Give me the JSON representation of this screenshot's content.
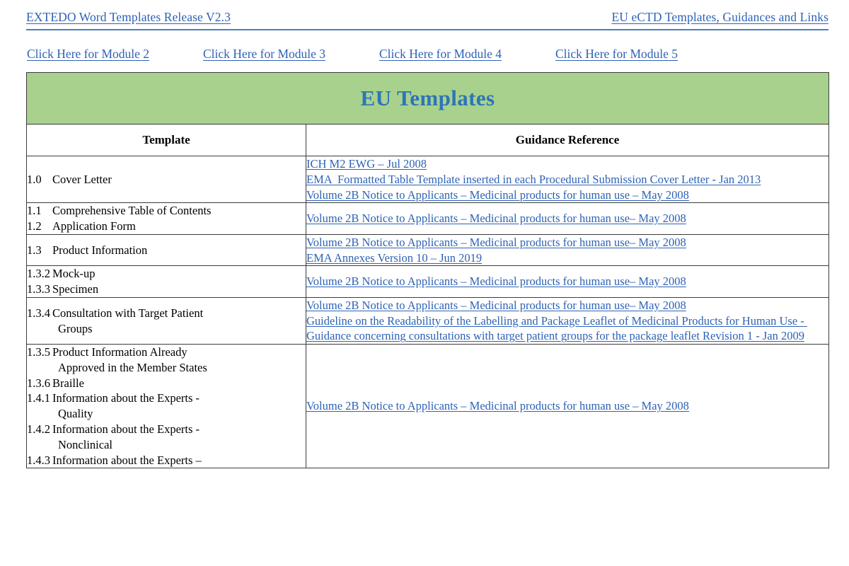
{
  "header": {
    "left_title": "EXTEDO Word Templates Release V2.3",
    "right_title": "EU eCTD Templates, Guidances and Links"
  },
  "module_links": [
    {
      "label": "Click Here for Module 2"
    },
    {
      "label": "Click Here for Module 3"
    },
    {
      "label": "Click Here for Module 4"
    },
    {
      "label": "Click Here for Module 5"
    }
  ],
  "table": {
    "banner_title": "EU Templates",
    "banner_color": "#a9d18e",
    "link_color": "#2e62b5",
    "columns": [
      {
        "label": "Template"
      },
      {
        "label": "Guidance Reference"
      }
    ],
    "rows": [
      {
        "template_lines": [
          {
            "num": "1.0",
            "text": "Cover Letter"
          }
        ],
        "template_align": "middle",
        "references": [
          "ICH M2 EWG – Jul 2008",
          "EMA  Formatted Table Template inserted in each Procedural Submission Cover Letter - Jan 2013",
          "Volume 2B Notice to Applicants – Medicinal products for human use – May 2008"
        ],
        "reference_align": "top"
      },
      {
        "template_lines": [
          {
            "num": "1.1",
            "text": "Comprehensive Table of Contents"
          },
          {
            "num": "1.2",
            "text": "Application Form"
          }
        ],
        "template_align": "top",
        "references": [
          "Volume 2B Notice to Applicants – Medicinal products for human use– May 2008"
        ],
        "reference_align": "middle"
      },
      {
        "template_lines": [
          {
            "num": "1.3",
            "text": "Product Information"
          }
        ],
        "template_align": "middle",
        "references": [
          "Volume 2B Notice to Applicants – Medicinal products for human use– May 2008",
          "EMA Annexes Version 10 – Jun 2019"
        ],
        "reference_align": "middle"
      },
      {
        "template_lines": [
          {
            "num": "1.3.2",
            "text": "Mock-up"
          },
          {
            "num": "1.3.3",
            "text": "Specimen"
          }
        ],
        "template_align": "middle",
        "references": [
          "Volume 2B Notice to Applicants – Medicinal products for human use– May 2008"
        ],
        "reference_align": "middle"
      },
      {
        "template_lines": [
          {
            "num": "1.3.4",
            "text": "Consultation with Target Patient"
          },
          {
            "num": "",
            "text": "Groups",
            "indent": true
          }
        ],
        "template_align": "middle",
        "references": [
          "Volume 2B Notice to Applicants – Medicinal products for human use– May 2008",
          "Guideline on the Readability of the Labelling and Package Leaflet of Medicinal Products for Human Use - Guidance concerning consultations with target patient groups for the package leaflet Revision 1 - Jan 2009"
        ],
        "reference_align": "top"
      },
      {
        "template_lines": [
          {
            "num": "1.3.5",
            "text": "Product Information Already"
          },
          {
            "num": "",
            "text": "Approved in the Member States",
            "indent": true
          },
          {
            "num": "1.3.6",
            "text": "Braille"
          },
          {
            "num": "1.4.1",
            "text": "Information about the Experts -"
          },
          {
            "num": "",
            "text": "Quality",
            "indent": true
          },
          {
            "num": "1.4.2",
            "text": "Information about the Experts -"
          },
          {
            "num": "",
            "text": "Nonclinical",
            "indent": true
          },
          {
            "num": "1.4.3",
            "text": "Information about the Experts –"
          }
        ],
        "template_align": "top",
        "references": [
          "Volume 2B Notice to Applicants – Medicinal products for human use – May 2008"
        ],
        "reference_align": "middle"
      }
    ]
  }
}
